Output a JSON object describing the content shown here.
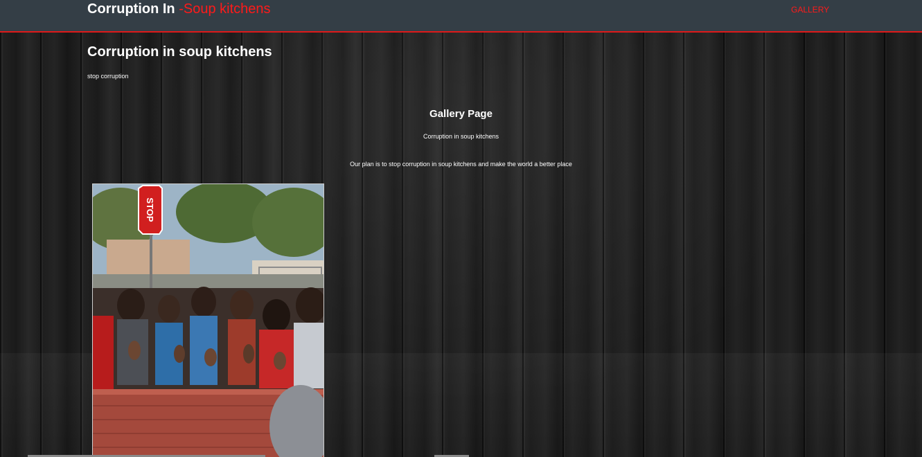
{
  "header": {
    "brand_main": "Corruption In",
    "brand_accent": "-Soup kitchens",
    "nav_gallery": "GALLERY"
  },
  "main": {
    "title": "Corruption in soup kitchens",
    "subtitle": "stop corruption"
  },
  "gallery": {
    "heading": "Gallery Page",
    "subheading": "Corruption in soup kitchens",
    "plan": "Our plan is to stop corruption in soup kitchens and make the world a better place",
    "photo_sign_text": "STOP"
  },
  "colors": {
    "header_bg": "#343e46",
    "accent": "#ff1a1a",
    "border": "#e01919",
    "text": "#ffffff"
  }
}
